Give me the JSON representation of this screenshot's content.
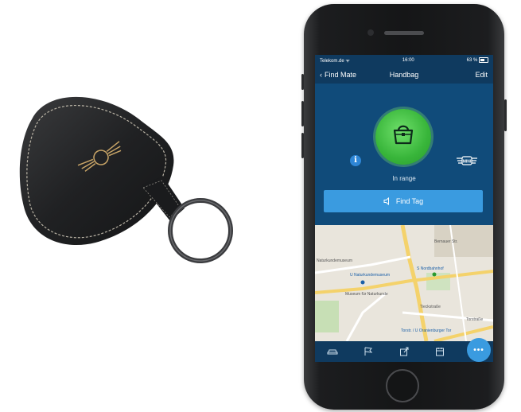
{
  "status_bar": {
    "carrier": "Telekom.de",
    "time": "16:00",
    "battery": "63 %"
  },
  "navbar": {
    "back_label": "Find Mate",
    "title": "Handbag",
    "edit_label": "Edit"
  },
  "tag": {
    "status": "In range",
    "find_button_label": "Find Tag",
    "logo_text": "MINI"
  },
  "map": {
    "labels": [
      "Naturkundemuseum",
      "U Naturkundemuseum",
      "S Nordbahnhof",
      "Tieckstraße",
      "Torstr. / U Oranienburger Tor",
      "Torstraße",
      "Museum für Naturkunde",
      "Bernauer Str."
    ]
  },
  "tabs": [
    {
      "icon": "car-icon"
    },
    {
      "icon": "flag-icon"
    },
    {
      "icon": "share-icon"
    },
    {
      "icon": "calendar-icon"
    },
    {
      "icon": "more-icon"
    }
  ],
  "tab_more_label": "•••",
  "colors": {
    "header": "#0f3a5f",
    "screen": "#104b7a",
    "accent": "#3a9be0",
    "in_range": "#38b53a"
  }
}
